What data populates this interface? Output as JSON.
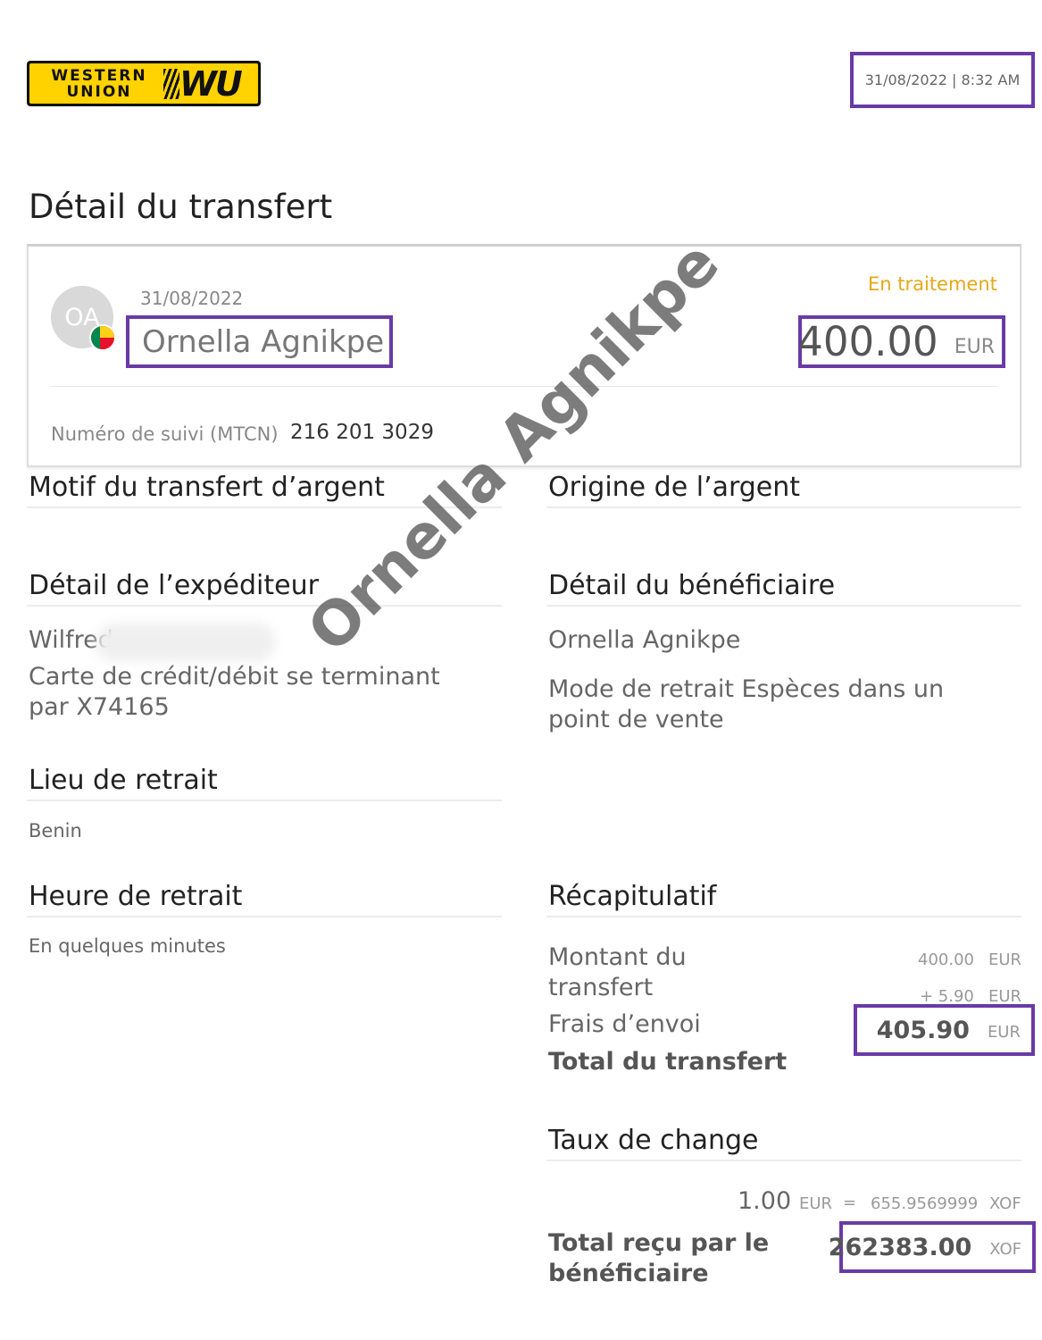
{
  "brand": {
    "logo_text": "WESTERN UNION",
    "logo_mark": "WU",
    "logo_color": "#ffd200"
  },
  "header": {
    "datetime": "31/08/2022 | 8:32 AM"
  },
  "page": {
    "title": "Détail du transfert"
  },
  "card": {
    "avatar_initials": "OA",
    "flag_icon": "benin-flag-icon",
    "date": "31/08/2022",
    "recipient_name": "Ornella Agnikpe",
    "status": "En traitement",
    "amount": "400.00",
    "currency": "EUR",
    "mtcn_label": "Numéro de suivi (MTCN)",
    "mtcn_value": "216 201 3029"
  },
  "sections": {
    "motif_title": "Motif du transfert d’argent",
    "origine_title": "Origine de l’argent",
    "sender_title": "Détail de l’expéditeur",
    "sender_name": "Wilfred",
    "sender_card": "Carte de crédit/débit se terminant par X74165",
    "beneficiary_title": "Détail du bénéficiaire",
    "beneficiary_name": "Ornella Agnikpe",
    "withdraw_mode": "Mode de retrait  Espèces dans un point de vente",
    "pickup_place_title": "Lieu de retrait",
    "pickup_place": "Benin",
    "pickup_time_title": "Heure de retrait",
    "pickup_time": "En quelques minutes"
  },
  "summary": {
    "title": "Récapitulatif",
    "amount_label": "Montant du transfert",
    "amount_value": "400.00",
    "amount_cur": "EUR",
    "fee_label": "Frais d’envoi",
    "fee_value": "+ 5.90",
    "fee_cur": "EUR",
    "total_label": "Total du transfert",
    "total_value": "405.90",
    "total_cur": "EUR"
  },
  "exchange": {
    "title": "Taux de change",
    "base_value": "1.00",
    "base_cur": "EUR",
    "equals": "=",
    "rate_value": "655.9569999",
    "rate_cur": "XOF",
    "received_label": "Total reçu par le bénéficiaire",
    "received_value": "262383.00",
    "received_cur": "XOF"
  },
  "watermark": "Ornella Agnikpe"
}
